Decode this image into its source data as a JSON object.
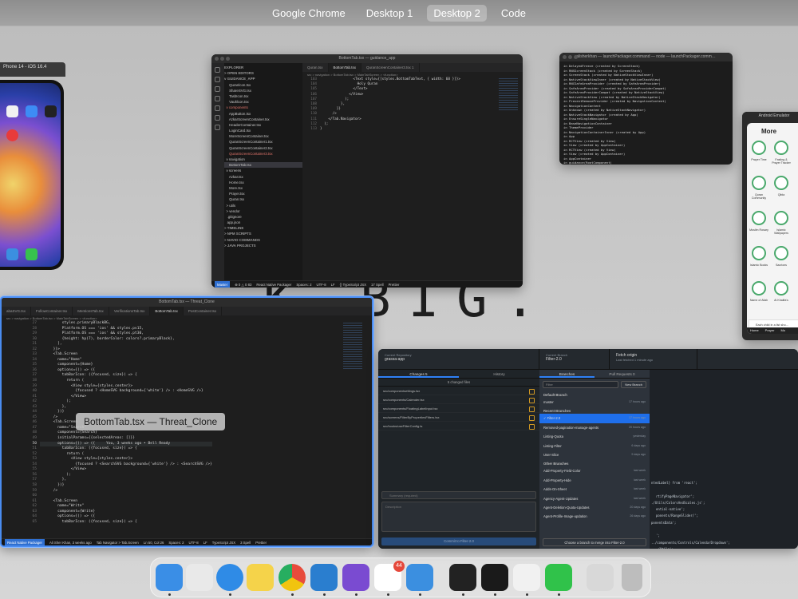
{
  "spaces": [
    "Google Chrome",
    "Desktop 1",
    "Desktop 2",
    "Code"
  ],
  "active_space": "Desktop 2",
  "wallpaper_text": "K BIG.",
  "simulator": {
    "title": "Phone 14 - iOS 16.4"
  },
  "vscode_top": {
    "title": "BottomTab.tsx — guidance_app",
    "explorer": [
      {
        "t": "EXPLORER",
        "c": "hdr"
      },
      {
        "t": "> OPEN EDITORS",
        "c": "hdr"
      },
      {
        "t": "v GUIDANCE_APP",
        "c": "hdr"
      },
      {
        "t": "     Quranlcon.tsx",
        "c": ""
      },
      {
        "t": "     ShareSVG.tsx",
        "c": ""
      },
      {
        "t": "     TasbIcon.tsx",
        "c": ""
      },
      {
        "t": "     Vaultlcon.tsx",
        "c": ""
      },
      {
        "t": "  v components",
        "c": "err"
      },
      {
        "t": "     AppButton.tsx",
        "c": ""
      },
      {
        "t": "     AzkarScreenContainer.tsx",
        "c": ""
      },
      {
        "t": "     HeaderContainer.tsx",
        "c": ""
      },
      {
        "t": "     LoginCard.tsx",
        "c": ""
      },
      {
        "t": "     MoreScreenContainer.tsx",
        "c": ""
      },
      {
        "t": "     QuranScreenContainer1.tsx",
        "c": ""
      },
      {
        "t": "     QuranScreenContainer2.tsx",
        "c": ""
      },
      {
        "t": "     QuranScreenContainer3.tsx",
        "c": "err"
      },
      {
        "t": "  v navigation",
        "c": ""
      },
      {
        "t": "     BottomTab.tsx",
        "c": "sel"
      },
      {
        "t": "  v screens",
        "c": ""
      },
      {
        "t": "     Azkar.tsx",
        "c": ""
      },
      {
        "t": "     Home.tsx",
        "c": ""
      },
      {
        "t": "     More.tsx",
        "c": ""
      },
      {
        "t": "     Prayer.tsx",
        "c": ""
      },
      {
        "t": "     Quran.tsx",
        "c": ""
      },
      {
        "t": "  > utils",
        "c": ""
      },
      {
        "t": "  > vendor",
        "c": ""
      },
      {
        "t": "   .gitignore",
        "c": ""
      },
      {
        "t": "   app.json",
        "c": ""
      },
      {
        "t": "> TIMELINE",
        "c": "hdr"
      },
      {
        "t": "> NPM SCRIPTS",
        "c": "hdr"
      },
      {
        "t": "> NAVIO COMMANDS",
        "c": "hdr"
      },
      {
        "t": "> JAVA PROJECTS",
        "c": "hdr"
      }
    ],
    "tabs": [
      "Quran.tsx",
      "BottomTab.tsx",
      "QuranScreenContainer3.tsx 1"
    ],
    "breadcrumb": "src > navigation > BottomTab.tsx > MainTabScreen > <function>",
    "code": [
      {
        "n": "103",
        "l": "                <Text style={[styles.BottomTabText, { width: 60 }]}>"
      },
      {
        "n": "104",
        "l": "                  Holy Quran"
      },
      {
        "n": "105",
        "l": "                </Text>"
      },
      {
        "n": "106",
        "l": "              </View>"
      },
      {
        "n": "107",
        "l": "            );"
      },
      {
        "n": "108",
        "l": "          },"
      },
      {
        "n": "109",
        "l": "        }}"
      },
      {
        "n": "110",
        "l": "      />"
      },
      {
        "n": "111",
        "l": "    </Tab.Navigator>"
      },
      {
        "n": "112",
        "l": "  );"
      },
      {
        "n": "113",
        "l": "}"
      }
    ],
    "status": [
      "Master",
      "⊗ 0 △ 0 83",
      "React Native Packager",
      "Spaces: 2",
      "UTF-8",
      "LF",
      "{} TypeScript JSX",
      "17 Spell",
      "Prettier"
    ]
  },
  "terminal": {
    "title": "alisherkhan — launchPackager.command — node — launchPackager.comm…",
    "lines": [
      "in DelayedFreeze (created by ScreenStack)",
      "in RNSScreenStack (created by ScreenStack)",
      "in ScreenStack (created by NativeStackViewInner)",
      "in NativeStackViewInner (created by NativeStackView)",
      "in RNCSafeAreaProvider (created by SafeAreaProvider)",
      "in SafeAreaProvider (created by SafeAreaProviderCompat)",
      "in SafeAreaProviderCompat (created by NativeStackView)",
      "in NativeStackView (created by NativeStackNavigator)",
      "in PreventRemoveProvider (created by NavigationContent)",
      "in NavigationContent",
      "in Unknown (created by NativeStackNavigator)",
      "in NativeStackNavigator (created by App)",
      "in EnsureSingleNavigator",
      "in BaseNavigationContainer",
      "in ThemeProvider",
      "in NavigationContainerInner (created by App)",
      "in App",
      "in RCTView (created by View)",
      "in View (created by AppContainer)",
      "in RCTView (created by View)",
      "in View (created by AppContainer)",
      "in AppContainer",
      "in guidance(RootComponent)"
    ]
  },
  "android": {
    "title": "Android Emulator",
    "header": "More",
    "features": [
      "Prayer Time",
      "Fasting & Prayer Tracker",
      "Quran Community",
      "Qibla",
      "Muslim Rosary",
      "Islamic Wallpapers",
      "Islamic Books",
      "Sacrions",
      "Name of Allah",
      "Al Khalifa's"
    ],
    "toast": "Each child in a list sho...",
    "nav": [
      "Home",
      "Prayer",
      "Mo"
    ]
  },
  "vscode_left": {
    "title": "BottomTab.tsx — Threat_Clone",
    "tabs": [
      "abaSVG.tsx",
      "FollowContainer.tsx",
      "MentionsTab.tsx",
      "VerificationsTab.tsx",
      "BottomTab.tsx",
      "PostContainer.tsx"
    ],
    "breadcrumb": "src > navigation > BottomTab.tsx > MainTabScreen > <function>",
    "code": [
      {
        "n": "27",
        "l": "          styles.primaryBlackBG,"
      },
      {
        "n": "28",
        "l": "          Platform.OS === 'ios' && styles.pv15,"
      },
      {
        "n": "29",
        "l": "          Platform.OS === 'ios' && styles.pt30,"
      },
      {
        "n": "30",
        "l": "          {height: hp(7), borderColor: colors?.primaryBlack},"
      },
      {
        "n": "31",
        "l": "        ],"
      },
      {
        "n": "32",
        "l": "      }}>"
      },
      {
        "n": "33",
        "l": "      <Tab.Screen"
      },
      {
        "n": "34",
        "l": "        name=\"Home\""
      },
      {
        "n": "35",
        "l": "        component={Home}"
      },
      {
        "n": "36",
        "l": "        options={() => ({"
      },
      {
        "n": "37",
        "l": "          tabBarIcon: ({focused, size}) => {"
      },
      {
        "n": "38",
        "l": "            return ("
      },
      {
        "n": "39",
        "l": "              <View style={styles.center}>"
      },
      {
        "n": "40",
        "l": "                {focused ? <HomeSVG background={'white'} /> : <HomeSVG />}"
      },
      {
        "n": "41",
        "l": "              </View>"
      },
      {
        "n": "42",
        "l": "            );"
      },
      {
        "n": "43",
        "l": "          },"
      },
      {
        "n": "44",
        "l": "        })}"
      },
      {
        "n": "45",
        "l": "      />"
      },
      {
        "n": "46",
        "l": "      <Tab.Screen"
      },
      {
        "n": "47",
        "l": "        name=\"Search\""
      },
      {
        "n": "48",
        "l": "        component={Search}"
      },
      {
        "n": "49",
        "l": "        initialParams={{selectedAreas: []}}"
      },
      {
        "n": "50",
        "l": "        options={() => ({     You, 3 weeks ago • Bell Ready"
      },
      {
        "n": "51",
        "l": "          tabBarIcon: ({focused, size}) => {"
      },
      {
        "n": "52",
        "l": "            return ("
      },
      {
        "n": "53",
        "l": "              <View style={styles.center}>"
      },
      {
        "n": "54",
        "l": "                {focused ? <SearchSVG background={'white'} /> : <SearchSVG />}"
      },
      {
        "n": "55",
        "l": "              </View>"
      },
      {
        "n": "56",
        "l": "            );"
      },
      {
        "n": "57",
        "l": "          },"
      },
      {
        "n": "58",
        "l": "        })}"
      },
      {
        "n": "59",
        "l": "      />"
      },
      {
        "n": "60",
        "l": ""
      },
      {
        "n": "61",
        "l": "      <Tab.Screen"
      },
      {
        "n": "62",
        "l": "        name=\"Write\""
      },
      {
        "n": "63",
        "l": "        component={Write}"
      },
      {
        "n": "64",
        "l": "        options={() => ({"
      },
      {
        "n": "65",
        "l": "          tabBarIcon: ({focused, size}) => {"
      }
    ],
    "status": [
      "React Native Packager",
      "Ali Sher Khan, 3 weeks ago",
      "Tab Navigator > Tab.Screen",
      "Ln 50, Col 26",
      "Spaces: 2",
      "UTF-8",
      "LF",
      "TypeScript JSX",
      "3 Spell",
      "Prettier"
    ]
  },
  "hover_label": "BottomTab.tsx — Threat_Clone",
  "github_desktop": {
    "repo_label": "Current Repository",
    "repo": "grassa-app",
    "branch_label": "Current Branch",
    "branch": "Filter-2.0",
    "fetch_label": "Fetch origin",
    "fetch_sub": "Last fetched 1 minute ago",
    "tab_changes": "Changes",
    "changes_count": "5",
    "tab_history": "History",
    "changed_files_label": "5 changed files",
    "files": [
      "src/componentsettings.tsx",
      "src/components/Calender.tsx",
      "src/components/FloatingLabelInput.tsx",
      "src/screens/FilterByPropertiesFilters.tsx",
      "src/hooks/useFilterConfig.ts"
    ],
    "summary_placeholder": "Summary (required)",
    "description_placeholder": "Description",
    "commit_button": "Commit to Filter-2.0",
    "branches_tab": "Branches",
    "pull_requests_tab": "Pull Requests",
    "pr_count": "0",
    "filter_placeholder": "Filter",
    "new_branch": "New Branch",
    "default_branch_heading": "Default Branch",
    "default_branch": {
      "name": "master",
      "time": "17 hours ago"
    },
    "recent_heading": "Recent Branches",
    "recent": [
      {
        "name": "✓ Filter-2.0",
        "time": "17 hours ago"
      },
      {
        "name": "Removed-pagination-manage-agents",
        "time": "20 hours ago"
      },
      {
        "name": "Listing-Quota",
        "time": "yesterday"
      },
      {
        "name": "Listing-Filter",
        "time": "6 days ago"
      },
      {
        "name": "User-Slice",
        "time": "9 days ago"
      }
    ],
    "other_heading": "Other Branches",
    "other": [
      {
        "name": "Add-Property-Field-Color",
        "time": "last week"
      },
      {
        "name": "Add-Property-Hide",
        "time": "last week"
      },
      {
        "name": "Adds-On-Sheet",
        "time": "last week"
      },
      {
        "name": "Agency-Agent-Updates",
        "time": "last week"
      },
      {
        "name": "Agent-Deletion-Quota-Updates",
        "time": "20 days ago"
      },
      {
        "name": "Agent-Profile-Image-updation",
        "time": "26 days ago"
      }
    ],
    "merge_button": "Choose a branch to merge into Filter-2.0",
    "diff_snippet": [
      "ntedLabel} from 'react';",
      "",
      "rtifyPageNavigator';",
      "./Utils/ColorsAndScales.js';",
      "ential-native';",
      "ponents/RangeSlider/';",
      "ponentsData';",
      "",
      "';",
      "../components/Controls/CalendarDropdown';",
      "./Utils';"
    ]
  },
  "dock": {
    "apps": [
      {
        "name": "finder-icon",
        "color": "#3a8ee6"
      },
      {
        "name": "launchpad-icon",
        "color": "#e9e9e9"
      },
      {
        "name": "safari-icon",
        "color": "#2f8be6"
      },
      {
        "name": "notes-icon",
        "color": "#f5d34a"
      },
      {
        "name": "chrome-icon",
        "color": "#ffffff"
      },
      {
        "name": "vscode-icon",
        "color": "#2a7ecf"
      },
      {
        "name": "github-desktop-icon",
        "color": "#7a4bd1"
      },
      {
        "name": "slack-icon",
        "color": "#ffffff"
      },
      {
        "name": "xcode-icon",
        "color": "#3b8fe0"
      },
      {
        "name": "activity-monitor-icon",
        "color": "#222222"
      },
      {
        "name": "terminal-icon",
        "color": "#1a1a1a"
      },
      {
        "name": "android-studio-icon",
        "color": "#f1f1f1"
      },
      {
        "name": "whatsapp-icon",
        "color": "#30c24a"
      },
      {
        "name": "store-folder-icon",
        "color": "#d8d8d8"
      },
      {
        "name": "trash-icon",
        "color": "#bdbdbd"
      }
    ],
    "slack_badge": "44"
  }
}
